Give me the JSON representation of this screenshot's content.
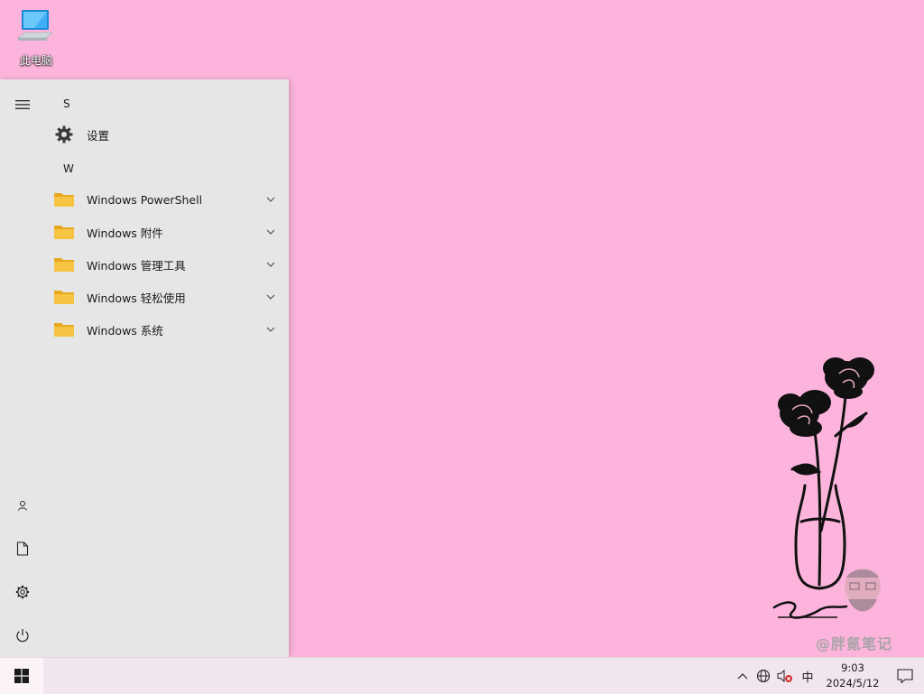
{
  "desktop": {
    "icons": [
      {
        "label": "此电脑",
        "icon": "computer-icon"
      }
    ]
  },
  "start_menu": {
    "rail": [
      {
        "name": "hamburger-menu",
        "icon": "hamburger-icon"
      },
      {
        "name": "user",
        "icon": "user-icon"
      },
      {
        "name": "documents",
        "icon": "document-icon"
      },
      {
        "name": "settings",
        "icon": "gear-icon"
      },
      {
        "name": "power",
        "icon": "power-icon"
      }
    ],
    "groups": [
      {
        "letter": "S",
        "items": [
          {
            "label": "设置",
            "icon": "gear-icon",
            "expandable": false
          }
        ]
      },
      {
        "letter": "W",
        "items": [
          {
            "label": "Windows PowerShell",
            "icon": "folder-icon",
            "expandable": true
          },
          {
            "label": "Windows 附件",
            "icon": "folder-icon",
            "expandable": true
          },
          {
            "label": "Windows 管理工具",
            "icon": "folder-icon",
            "expandable": true
          },
          {
            "label": "Windows 轻松使用",
            "icon": "folder-icon",
            "expandable": true
          },
          {
            "label": "Windows 系统",
            "icon": "folder-icon",
            "expandable": true
          }
        ]
      }
    ]
  },
  "taskbar": {
    "start_icon": "windows-logo-icon",
    "tray": {
      "overflow_icon": "chevron-up-icon",
      "network_icon": "globe-network-icon",
      "volume_icon": "speaker-muted-icon",
      "ime": "中",
      "time": "9:03",
      "date": "2024/5/12",
      "notification_icon": "notification-icon"
    }
  },
  "wallpaper": {
    "signature": "Zemo",
    "watermark": "@胖氪笔记"
  },
  "colors": {
    "desktop": "#fdb4dc",
    "start_menu": "#e6e6e6",
    "taskbar": "#f2e6ee",
    "folder": "#f6c343"
  }
}
